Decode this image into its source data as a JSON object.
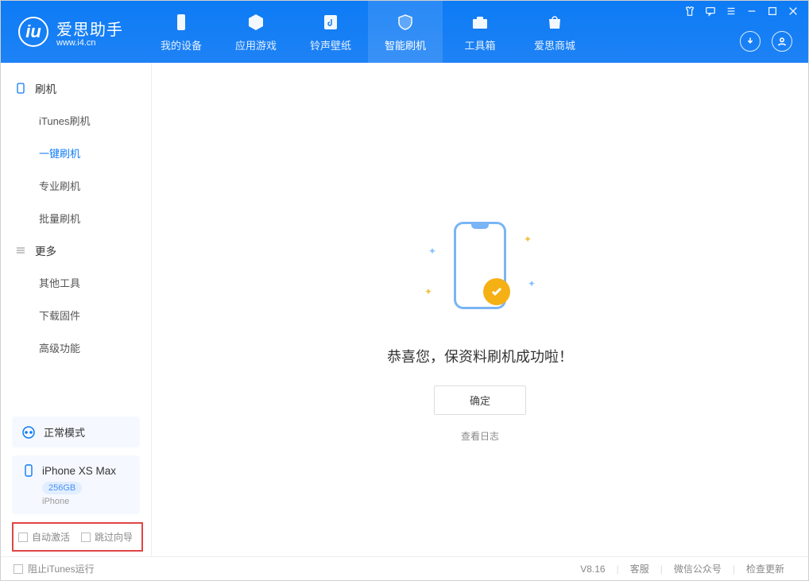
{
  "app": {
    "name_cn": "爱思助手",
    "url": "www.i4.cn"
  },
  "tabs": [
    {
      "label": "我的设备"
    },
    {
      "label": "应用游戏"
    },
    {
      "label": "铃声壁纸"
    },
    {
      "label": "智能刷机"
    },
    {
      "label": "工具箱"
    },
    {
      "label": "爱思商城"
    }
  ],
  "sidebar": {
    "group1_title": "刷机",
    "group1_items": [
      {
        "label": "iTunes刷机"
      },
      {
        "label": "一键刷机"
      },
      {
        "label": "专业刷机"
      },
      {
        "label": "批量刷机"
      }
    ],
    "group2_title": "更多",
    "group2_items": [
      {
        "label": "其他工具"
      },
      {
        "label": "下载固件"
      },
      {
        "label": "高级功能"
      }
    ]
  },
  "mode": {
    "label": "正常模式"
  },
  "device": {
    "name": "iPhone XS Max",
    "capacity": "256GB",
    "type": "iPhone"
  },
  "checkboxes": {
    "auto_activate": "自动激活",
    "skip_guide": "跳过向导"
  },
  "main": {
    "success_msg": "恭喜您，保资料刷机成功啦！",
    "ok_btn": "确定",
    "view_log": "查看日志"
  },
  "status": {
    "block_itunes": "阻止iTunes运行",
    "version": "V8.16",
    "service": "客服",
    "wechat": "微信公众号",
    "check_update": "检查更新"
  }
}
